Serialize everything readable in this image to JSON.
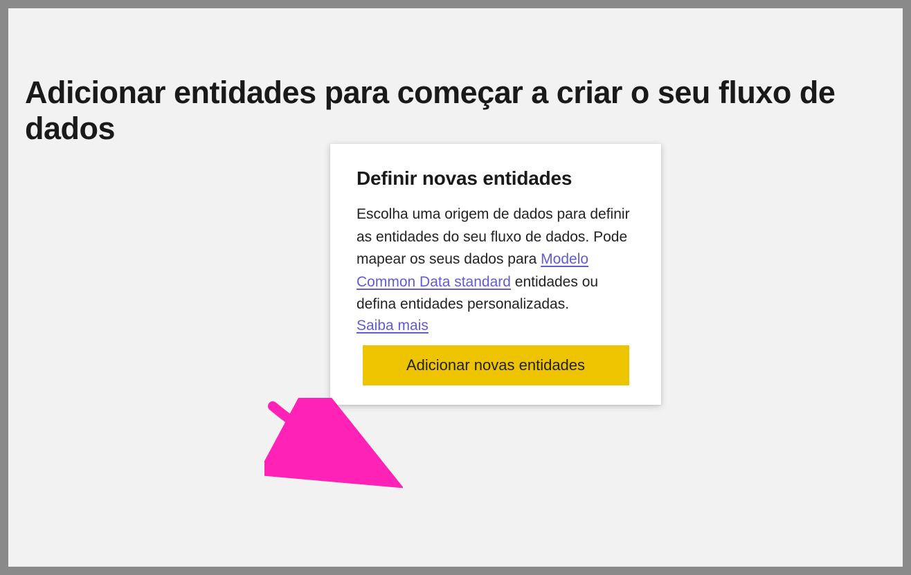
{
  "page": {
    "title": "Adicionar entidades para começar a criar o seu fluxo de dados"
  },
  "card": {
    "title": "Definir novas entidades",
    "body_pre": "Escolha uma origem de dados para definir as entidades do seu fluxo de dados. Pode mapear os seus dados para ",
    "link_text": "Modelo Common Data standard",
    "body_post": " entidades ou defina entidades personalizadas.",
    "learn_more": "Saiba mais",
    "button_label": "Adicionar novas entidades"
  },
  "colors": {
    "accent_yellow": "#eec300",
    "link_purple": "#605bd6",
    "annotation_pink": "#ff22b6"
  }
}
